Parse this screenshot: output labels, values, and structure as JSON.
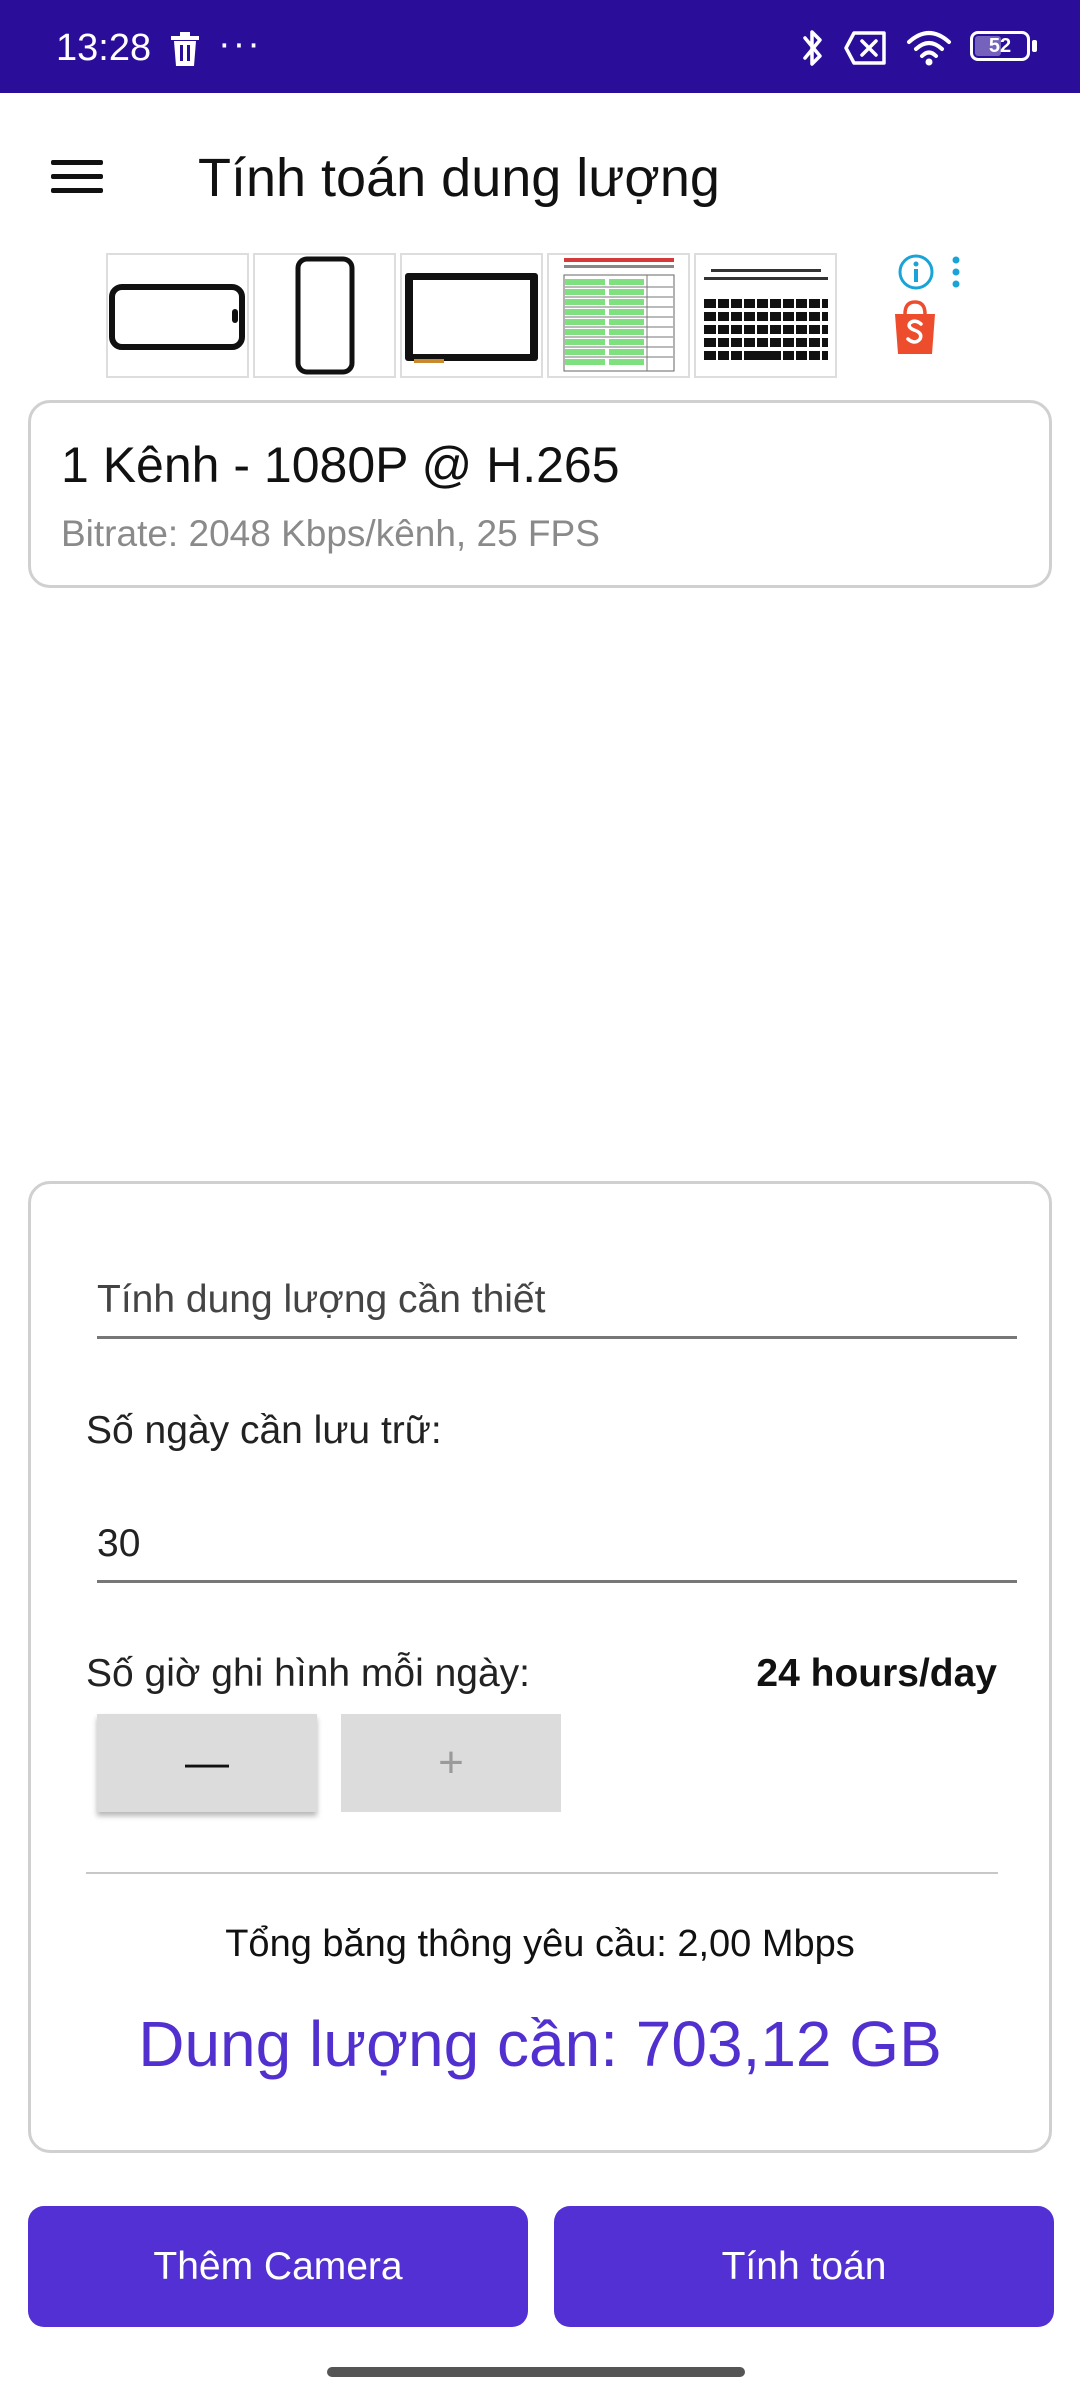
{
  "status_bar": {
    "time": "13:28",
    "more": "···",
    "battery": "52"
  },
  "app_bar": {
    "title": "Tính toán dung lượng"
  },
  "ads": {
    "items": [
      "phone-screen-glass-icon",
      "phone-glass-icon",
      "tablet-touch-panel-icon",
      "price-list-sheet-icon",
      "laptop-keyboard-icon"
    ],
    "shop_icon": "shopee-bag-icon",
    "brand_color": "#ee4d2d"
  },
  "camera_card": {
    "title": "1 Kênh - 1080P @ H.265",
    "subtitle": "Bitrate: 2048 Kbps/kênh, 25 FPS"
  },
  "calc": {
    "need_placeholder": "Tính dung lượng cần thiết",
    "days_label": "Số ngày cần lưu trữ:",
    "days_value": "30",
    "hours_label": "Số giờ ghi hình mỗi ngày:",
    "hours_value": "24 hours/day",
    "minus_label": "—",
    "plus_label": "+",
    "bandwidth_text": "Tổng băng thông yêu cầu: 2,00 Mbps",
    "capacity_text": "Dung lượng cần: 703,12 GB"
  },
  "buttons": {
    "add_camera": "Thêm Camera",
    "calculate": "Tính toán"
  },
  "colors": {
    "status_bar": "#2a0e9a",
    "accent": "#5330d4",
    "capacity_text": "#5130cf"
  }
}
